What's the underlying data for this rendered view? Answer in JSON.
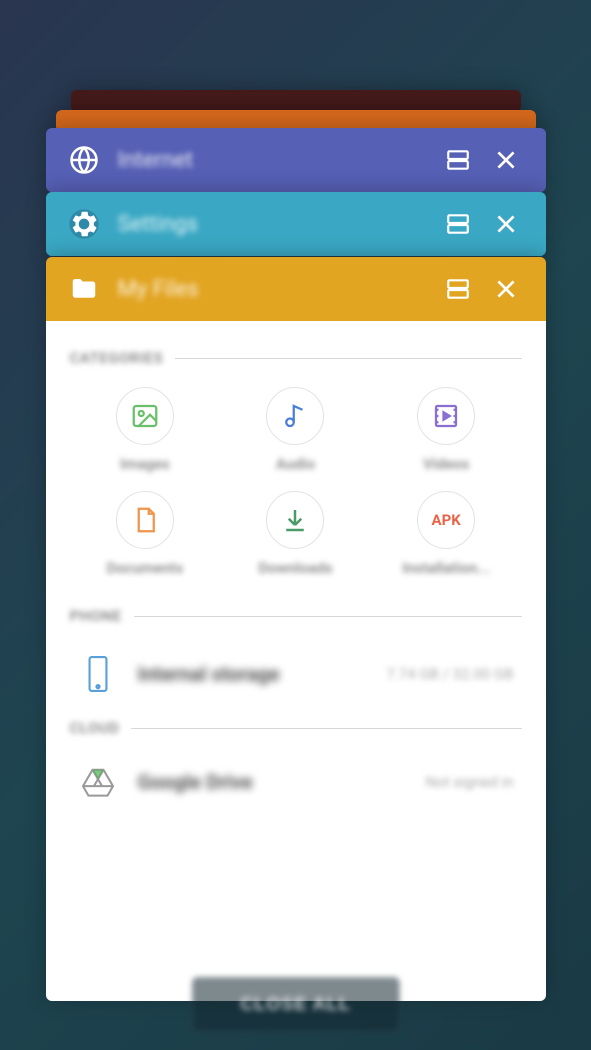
{
  "recents": {
    "cards": [
      {
        "app": "Internet",
        "color": "#5660b5"
      },
      {
        "app": "Settings",
        "color": "#3aa8c4"
      },
      {
        "app": "My Files",
        "color": "#e2a522"
      }
    ]
  },
  "myfiles": {
    "sections": {
      "categories_label": "CATEGORIES",
      "phone_label": "PHONE",
      "cloud_label": "CLOUD"
    },
    "categories": [
      {
        "name": "Images",
        "icon": "image",
        "color": "#6ac06a"
      },
      {
        "name": "Audio",
        "icon": "audio",
        "color": "#4a7fd8"
      },
      {
        "name": "Videos",
        "icon": "video",
        "color": "#8a6fd0"
      },
      {
        "name": "Documents",
        "icon": "document",
        "color": "#f0944a"
      },
      {
        "name": "Downloads",
        "icon": "download",
        "color": "#4a9a6a"
      },
      {
        "name": "Installation...",
        "icon": "apk",
        "color": "#e8654a"
      }
    ],
    "storage": {
      "internal": {
        "name": "Internal storage",
        "meta": "7.74 GB / 32.00 GB"
      },
      "drive": {
        "name": "Google Drive",
        "meta": "Not signed in"
      }
    }
  },
  "close_all_label": "CLOSE ALL"
}
